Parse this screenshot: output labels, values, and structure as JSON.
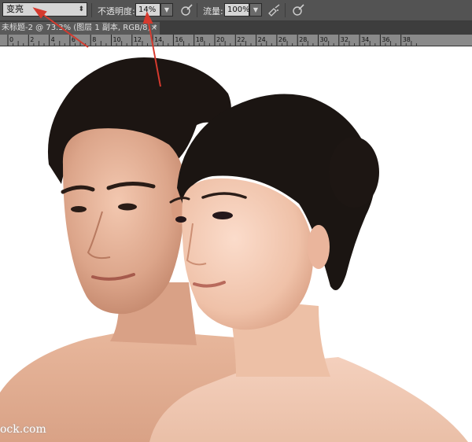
{
  "options_bar": {
    "blend_mode": "变亮",
    "opacity_label": "不透明度:",
    "opacity_value": "14%",
    "flow_label": "流量:",
    "flow_value": "100%"
  },
  "document_tab": {
    "title": "未标题-2 @ 73.3% (图层 1 副本, RGB/8) *",
    "close_glyph": "×"
  },
  "ruler": {
    "ticks": [
      "0",
      "2",
      "4",
      "6",
      "8",
      "10",
      "12",
      "14",
      "16",
      "18",
      "20",
      "22",
      "24",
      "26",
      "28",
      "30",
      "32",
      "34",
      "36",
      "38"
    ]
  },
  "canvas": {
    "watermark": "ock.com"
  },
  "colors": {
    "annotation_arrow": "#d63a2e",
    "panel": "#535353",
    "canvas_bg": "#ffffff"
  },
  "icons": {
    "airbrush": "airbrush-icon",
    "pressure_opacity": "pressure-opacity-icon",
    "pressure_size": "pressure-size-icon"
  }
}
